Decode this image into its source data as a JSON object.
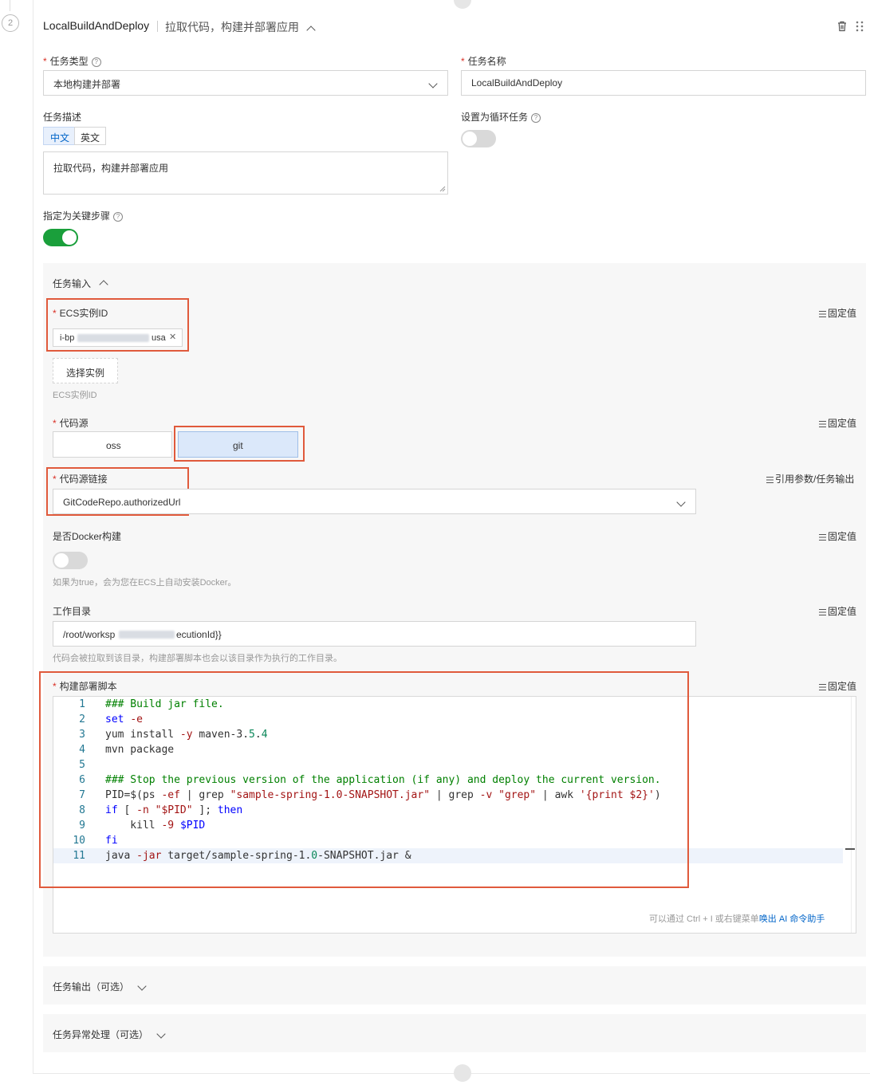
{
  "step": {
    "number": "2"
  },
  "header": {
    "task_id": "LocalBuildAndDeploy",
    "description": "拉取代码，构建并部署应用"
  },
  "fields": {
    "task_type": {
      "label": "任务类型",
      "value": "本地构建并部署"
    },
    "task_name": {
      "label": "任务名称",
      "value": "LocalBuildAndDeploy"
    },
    "task_desc": {
      "label": "任务描述",
      "lang_tabs": [
        "中文",
        "英文"
      ],
      "active_lang": "中文",
      "value": "拉取代码，构建并部署应用"
    },
    "loop_task": {
      "label": "设置为循环任务",
      "enabled": false
    },
    "key_step": {
      "label": "指定为关键步骤",
      "enabled": true
    }
  },
  "task_input": {
    "title": "任务输入",
    "fixed_value_label": "固定值",
    "ecs_instance": {
      "label": "ECS实例ID",
      "tag_prefix": "i-bp",
      "tag_suffix": "usa",
      "select_button": "选择实例",
      "hint": "ECS实例ID"
    },
    "code_source": {
      "label": "代码源",
      "options": [
        "oss",
        "git"
      ],
      "selected": "git"
    },
    "code_link": {
      "label": "代码源链接",
      "value": "GitCodeRepo.authorizedUrl",
      "ref_label": "引用参数/任务输出"
    },
    "docker_build": {
      "label": "是否Docker构建",
      "enabled": false,
      "hint": "如果为true，会为您在ECS上自动安装Docker。"
    },
    "workdir": {
      "label": "工作目录",
      "value_prefix": "/root/worksp",
      "value_suffix": "ecutionId}}",
      "hint": "代码会被拉取到该目录，构建部署脚本也会以该目录作为执行的工作目录。"
    },
    "script": {
      "label": "构建部署脚本",
      "footer_hint": "可以通过 Ctrl + I 或右键菜单",
      "footer_link": "唤出 AI 命令助手",
      "lines": [
        "### Build jar file.",
        "set -e",
        "yum install -y maven-3.5.4",
        "mvn package",
        "",
        "### Stop the previous version of the application (if any) and deploy the current version.",
        "PID=$(ps -ef | grep \"sample-spring-1.0-SNAPSHOT.jar\" | grep -v \"grep\" | awk '{print $2}')",
        "if [ -n \"$PID\" ]; then",
        "    kill -9 $PID",
        "fi",
        "java -jar target/sample-spring-1.0-SNAPSHOT.jar &"
      ]
    }
  },
  "task_output": {
    "title": "任务输出（可选）"
  },
  "task_exception": {
    "title": "任务异常处理（可选）"
  },
  "colors": {
    "toggle_on": "#1a9f3b",
    "highlight_box": "#e05a3c",
    "link": "#0064c8",
    "selected_option_bg": "#dbe8fa"
  }
}
